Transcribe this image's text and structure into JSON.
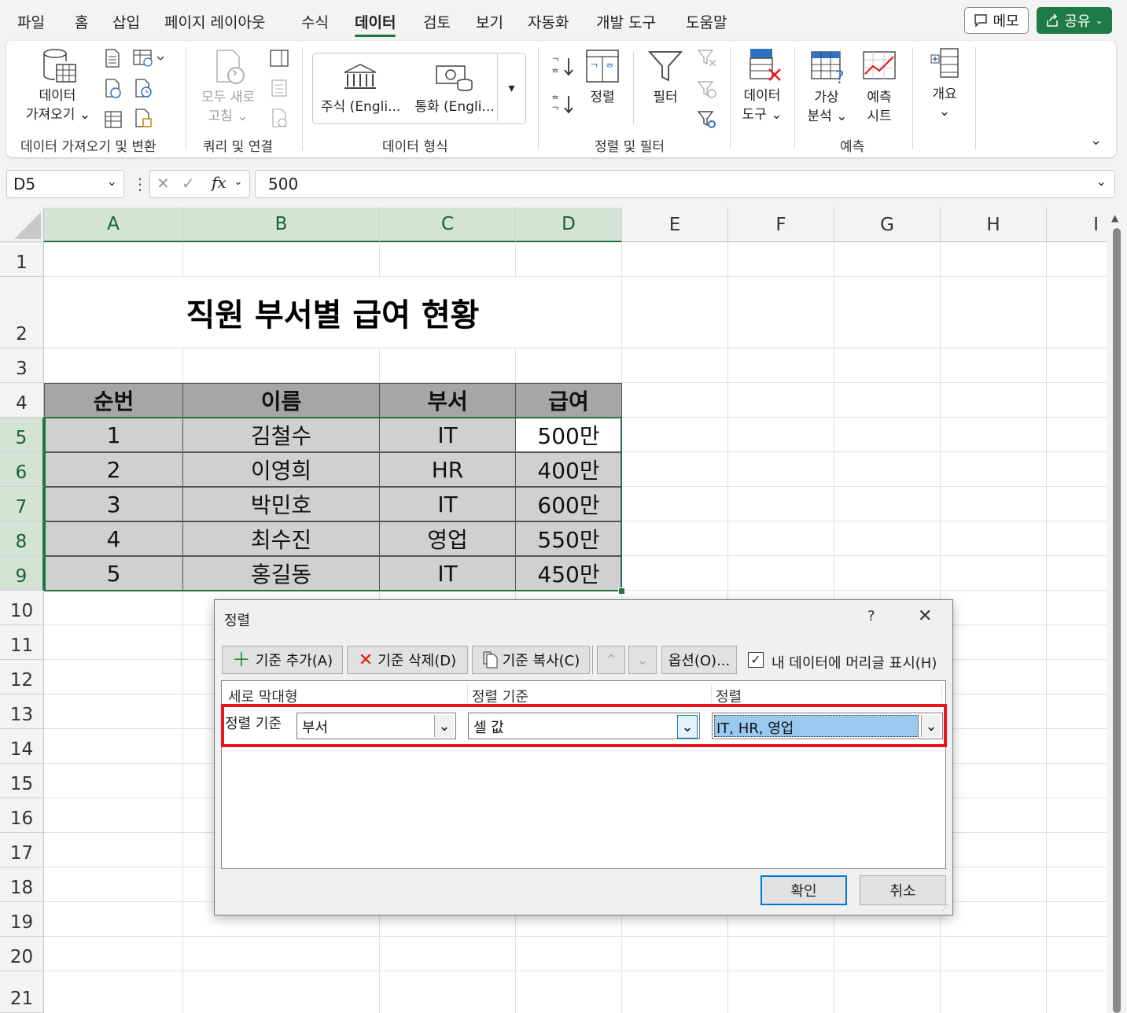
{
  "menu": {
    "tabs": [
      "파일",
      "홈",
      "삽입",
      "페이지 레이아웃",
      "수식",
      "데이터",
      "검토",
      "보기",
      "자동화",
      "개발 도구",
      "도움말"
    ],
    "active_tab": "데이터",
    "memo_label": "메모",
    "share_label": "공유"
  },
  "ribbon": {
    "get_data_l1": "데이터",
    "get_data_l2": "가져오기",
    "get_transform_group": "데이터 가져오기 및 변환",
    "refresh_l1": "모두 새로",
    "refresh_l2": "고침",
    "queries_group": "쿼리 및 연결",
    "stocks_label": "주식 (Engli...",
    "currency_label": "통화 (Engli...",
    "data_types_group": "데이터 형식",
    "sort_label": "정렬",
    "filter_label": "필터",
    "sort_filter_group": "정렬 및 필터",
    "data_tools_l1": "데이터",
    "data_tools_l2": "도구",
    "whatif_l1": "가상",
    "whatif_l2": "분석",
    "forecast_l1": "예측",
    "forecast_l2": "시트",
    "forecast_group": "예측",
    "outline_label": "개요"
  },
  "formula_bar": {
    "name_box": "D5",
    "fx": "fx",
    "value": "500"
  },
  "sheet": {
    "columns": [
      "A",
      "B",
      "C",
      "D",
      "E",
      "F",
      "G",
      "H",
      "I"
    ],
    "rows": [
      "1",
      "2",
      "3",
      "4",
      "5",
      "6",
      "7",
      "8",
      "9",
      "10",
      "11",
      "12",
      "13",
      "14",
      "15",
      "16",
      "17",
      "18",
      "19",
      "20",
      "21"
    ],
    "title": "직원 부서별 급여 현황",
    "headers": [
      "순번",
      "이름",
      "부서",
      "급여"
    ],
    "data": [
      [
        "1",
        "김철수",
        "IT",
        "500만"
      ],
      [
        "2",
        "이영희",
        "HR",
        "400만"
      ],
      [
        "3",
        "박민호",
        "IT",
        "600만"
      ],
      [
        "4",
        "최수진",
        "영업",
        "550만"
      ],
      [
        "5",
        "홍길동",
        "IT",
        "450만"
      ]
    ]
  },
  "dialog": {
    "title": "정렬",
    "help": "?",
    "add_level": "기준 추가(A)",
    "delete_level": "기준 삭제(D)",
    "copy_level": "기준 복사(C)",
    "options": "옵션(O)...",
    "header_checkbox": "내 데이터에 머리글 표시(H)",
    "col_header_column": "세로 막대형",
    "col_header_sorton": "정렬 기준",
    "col_header_order": "정렬",
    "row_label": "정렬 기준",
    "column_value": "부서",
    "sorton_value": "셀 값",
    "order_value": "IT, HR, 영업",
    "ok": "확인",
    "cancel": "취소"
  },
  "colors": {
    "accent": "#217346",
    "highlight": "#e8141b"
  }
}
